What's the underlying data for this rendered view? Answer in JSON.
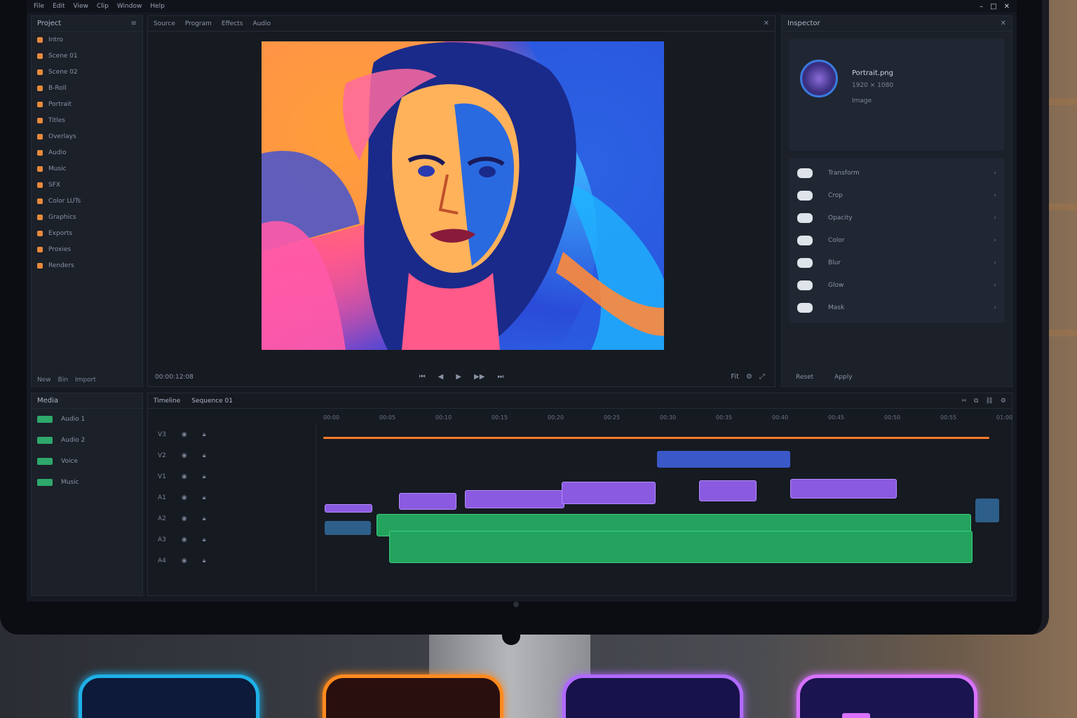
{
  "window": {
    "menu_items": [
      "File",
      "Edit",
      "View",
      "Clip",
      "Window",
      "Help"
    ],
    "controls": [
      "–",
      "□",
      "✕"
    ]
  },
  "project_panel": {
    "title": "Project",
    "items": [
      "Intro",
      "Scene 01",
      "Scene 02",
      "B-Roll",
      "Portrait",
      "Titles",
      "Overlays",
      "Audio",
      "Music",
      "SFX",
      "Color LUTs",
      "Graphics",
      "Exports",
      "Proxies",
      "Renders"
    ],
    "footer": [
      "New",
      "Bin",
      "Import"
    ]
  },
  "viewer": {
    "tabs": [
      "Source",
      "Program",
      "Effects",
      "Audio"
    ],
    "timecode": "00:00:12:08",
    "transport": [
      "⏮",
      "◀",
      "▶",
      "▶▶",
      "⏭"
    ],
    "right_controls": [
      "Fit",
      "⚙",
      "⤢"
    ]
  },
  "inspector": {
    "title": "Inspector",
    "profile_name": "Portrait.png",
    "profile_sub": "1920 × 1080",
    "profile_meta": "Image",
    "fx": [
      "Transform",
      "Crop",
      "Opacity",
      "Color",
      "Blur",
      "Glow",
      "Mask"
    ],
    "footer": [
      "Reset",
      "Apply"
    ]
  },
  "media_panel": {
    "title": "Media",
    "rows": [
      "Audio 1",
      "Audio 2",
      "Voice",
      "Music"
    ]
  },
  "timeline": {
    "title": "Timeline",
    "sequence": "Sequence 01",
    "tracks": [
      "V3",
      "V2",
      "V1",
      "A1",
      "A2",
      "A3",
      "A4"
    ],
    "ruler": [
      "00:00",
      "00:05",
      "00:10",
      "00:15",
      "00:20",
      "00:25",
      "00:30",
      "00:35",
      "00:40",
      "00:45",
      "00:50",
      "00:55",
      "01:00"
    ]
  },
  "colors": {
    "accent_orange": "#ff7a2a",
    "clip_purple": "#8a5ae0",
    "clip_green": "#23a35e",
    "clip_blue": "#3a58c8"
  }
}
